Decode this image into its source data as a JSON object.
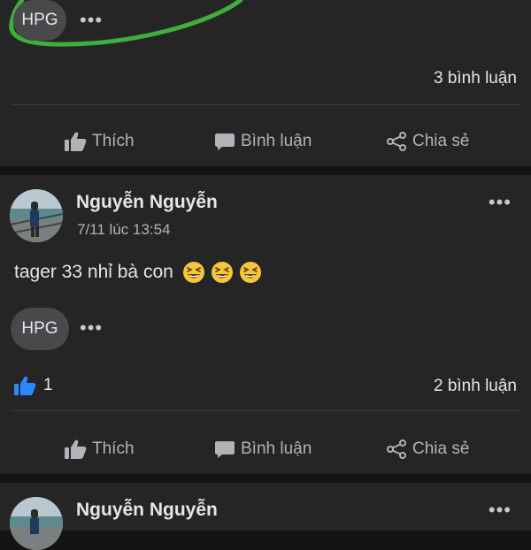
{
  "post1": {
    "tag": "HPG",
    "more": "•••",
    "comments": "3 bình luận"
  },
  "post2": {
    "author": "Nguyễn Nguyễn",
    "time": "7/11 lúc 13:54",
    "more": "•••",
    "text": "tager 33 nhỉ bà con",
    "emoji_count": 3,
    "tag": "HPG",
    "tag_more": "•••",
    "likes": "1",
    "comments": "2 bình luận"
  },
  "post3": {
    "author": "Nguyễn Nguyễn",
    "more": "•••"
  },
  "actions": {
    "like": "Thích",
    "comment": "Bình luận",
    "share": "Chia sẻ"
  },
  "colors": {
    "highlight_circle": "#3fae3a",
    "like_blue": "#2d88ff",
    "emoji_yellow": "#f7c53a"
  }
}
